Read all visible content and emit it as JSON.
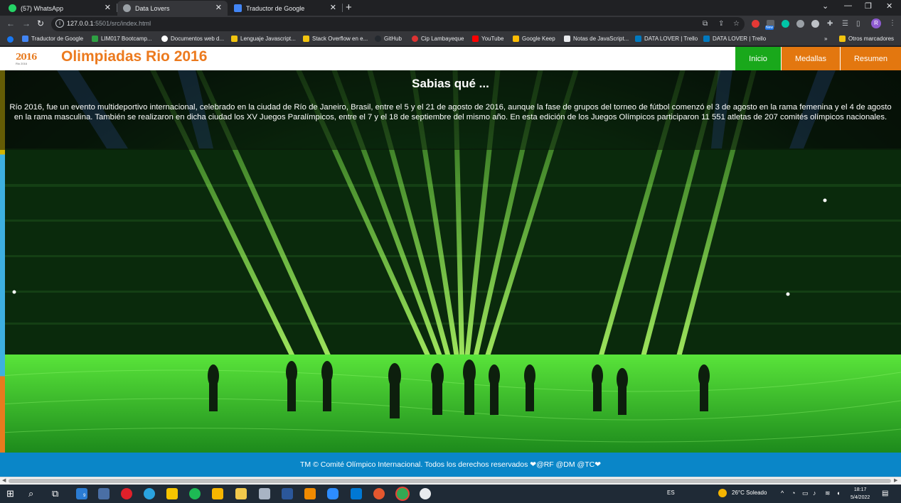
{
  "browser": {
    "tabs": [
      {
        "label": "(57) WhatsApp",
        "icon": "whatsapp-icon",
        "color": "#25d366"
      },
      {
        "label": "Data Lovers",
        "icon": "globe-icon",
        "color": "#9aa0a6"
      },
      {
        "label": "Traductor de Google",
        "icon": "google-translate-icon",
        "color": "#4285f4"
      }
    ],
    "address": {
      "host": "127.0.0.1",
      "path": ":5501/src/index.html"
    },
    "bookmarks": [
      {
        "label": "Traductor de Google",
        "color": "#4285f4"
      },
      {
        "label": "LIM017 Bootcamp...",
        "color": "#2ea043"
      },
      {
        "label": "Documentos web d...",
        "color": "#ffffff"
      },
      {
        "label": "Lenguaje Javascript...",
        "color": "#f1c40f"
      },
      {
        "label": "Stack Overflow en e...",
        "color": "#f1c40f"
      },
      {
        "label": "GitHub",
        "color": "#24292f"
      },
      {
        "label": "Cip Lambayeque",
        "color": "#d33"
      },
      {
        "label": "YouTube",
        "color": "#ff0000"
      },
      {
        "label": "Google Keep",
        "color": "#fbbc04"
      },
      {
        "label": "Notas de JavaScript...",
        "color": "#ffffff"
      },
      {
        "label": "DATA LOVER | Trello",
        "color": "#0079bf"
      },
      {
        "label": "DATA LOVER | Trello",
        "color": "#0079bf"
      }
    ],
    "other_bookmarks": "Otros marcadores",
    "profile_initial": "R",
    "ext_badge": "New"
  },
  "site": {
    "logo_text": "2016",
    "logo_sub": "Rio 2016",
    "title": "Olimpiadas Rio 2016",
    "nav": [
      "Inicio",
      "Medallas",
      "Resumen"
    ],
    "intro_title": "Sabias qué ...",
    "intro_text": "Río 2016, fue un evento multideportivo internacional, celebrado en la ciudad de Río de Janeiro, Brasil, entre el 5 y el 21 de agosto de 2016, aunque la fase de grupos del torneo de fútbol comenzó el 3 de agosto en la rama femenina y el 4 de agosto en la rama masculina. También se realizaron en dicha ciudad los XV Juegos Paralímpicos, entre el 7 y el 18 de septiembre del mismo año. En esta edición de los Juegos Olímpicos participaron 11 551 atletas de 207 comités olímpicos nacionales.",
    "footer": "TM © Comité Olímpico Internacional. Todos los derechos reservados ❤@RF @DM @TC❤",
    "colors": {
      "orange": "#e3770f",
      "green": "#19a81b",
      "blue": "#0a86c8"
    }
  },
  "taskbar": {
    "language": "ES",
    "weather": "26°C  Soleado",
    "time": "18:17",
    "date": "5/4/2022",
    "mail_badge": "9"
  }
}
